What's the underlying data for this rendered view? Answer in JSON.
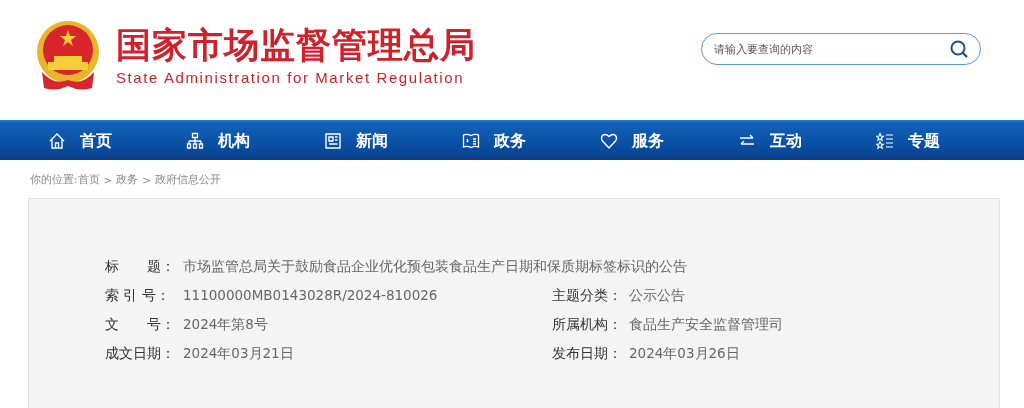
{
  "header": {
    "title": "国家市场监督管理总局",
    "subtitle": "State Administration for Market Regulation"
  },
  "search": {
    "placeholder": "请输入要查询的内容"
  },
  "nav": [
    {
      "label": "首页",
      "kind": "home"
    },
    {
      "label": "机构",
      "kind": "org"
    },
    {
      "label": "新闻",
      "kind": "news"
    },
    {
      "label": "政务",
      "kind": "affairs"
    },
    {
      "label": "服务",
      "kind": "service"
    },
    {
      "label": "互动",
      "kind": "interact"
    },
    {
      "label": "专题",
      "kind": "topic"
    }
  ],
  "breadcrumb": {
    "separator": ">",
    "items": [
      "你的位置:首页",
      "政务",
      "政府信息公开"
    ]
  },
  "info": {
    "title_label": "标　　题：",
    "title": "市场监管总局关于鼓励食品企业优化预包装食品生产日期和保质期标签标识的公告",
    "rows": [
      {
        "label": "索 引 号：",
        "value": "11100000MB0143028R/2024-810026",
        "label2": "主题分类：",
        "value2": "公示公告"
      },
      {
        "label": "文　　号：",
        "value": "2024年第8号",
        "label2": "所属机构：",
        "value2": "食品生产安全监督管理司"
      },
      {
        "label": "成文日期：",
        "value": "2024年03月21日",
        "label2": "发布日期：",
        "value2": "2024年03月26日"
      }
    ]
  }
}
